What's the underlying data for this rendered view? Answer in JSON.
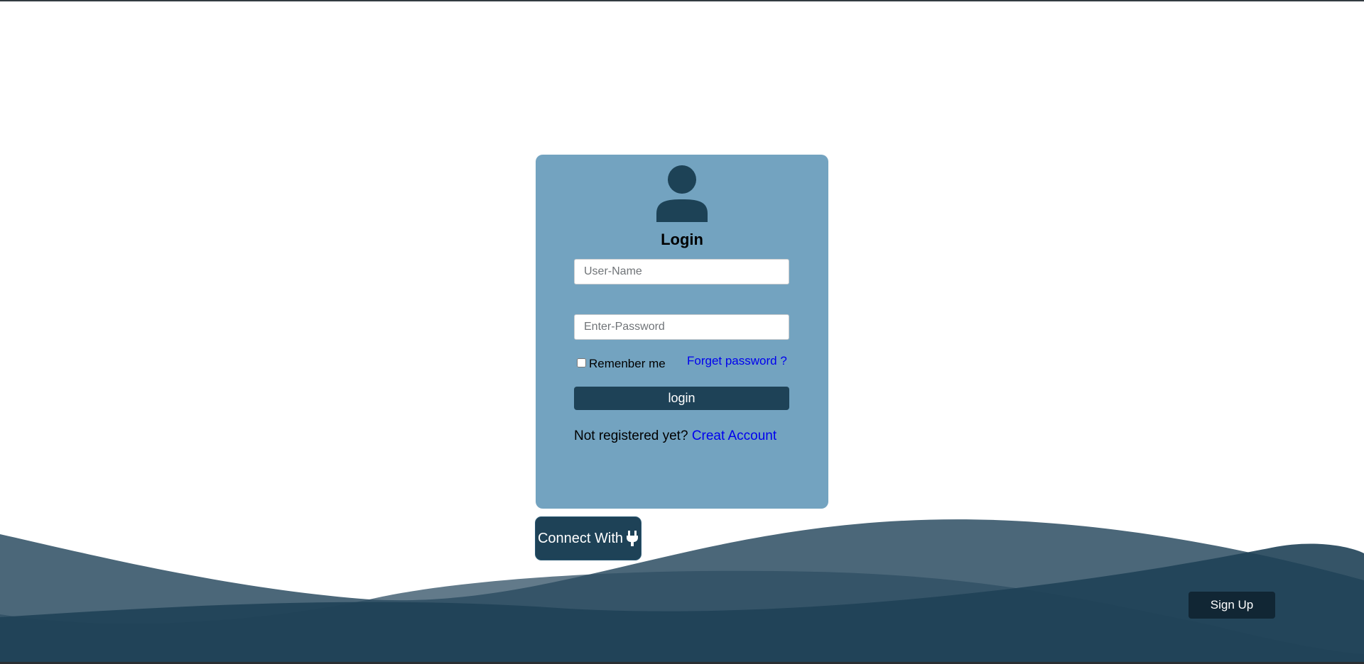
{
  "login_card": {
    "title": "Login",
    "username_placeholder": "User-Name",
    "password_placeholder": "Enter-Password",
    "remember_label": "Remenber me",
    "forgot_link": "Forget password ?",
    "login_button": "login",
    "register_prompt": "Not registered yet?",
    "register_link": "Creat Account"
  },
  "connect_button": {
    "label": "Connect With",
    "icon": "plug-icon"
  },
  "signup_button": {
    "label": "Sign Up"
  },
  "colors": {
    "card_background": "#73a3c0",
    "primary_dark": "#1e4257",
    "link": "#0000ee",
    "wave_light": "#4a6a7e",
    "wave_dark": "#1f4156"
  }
}
